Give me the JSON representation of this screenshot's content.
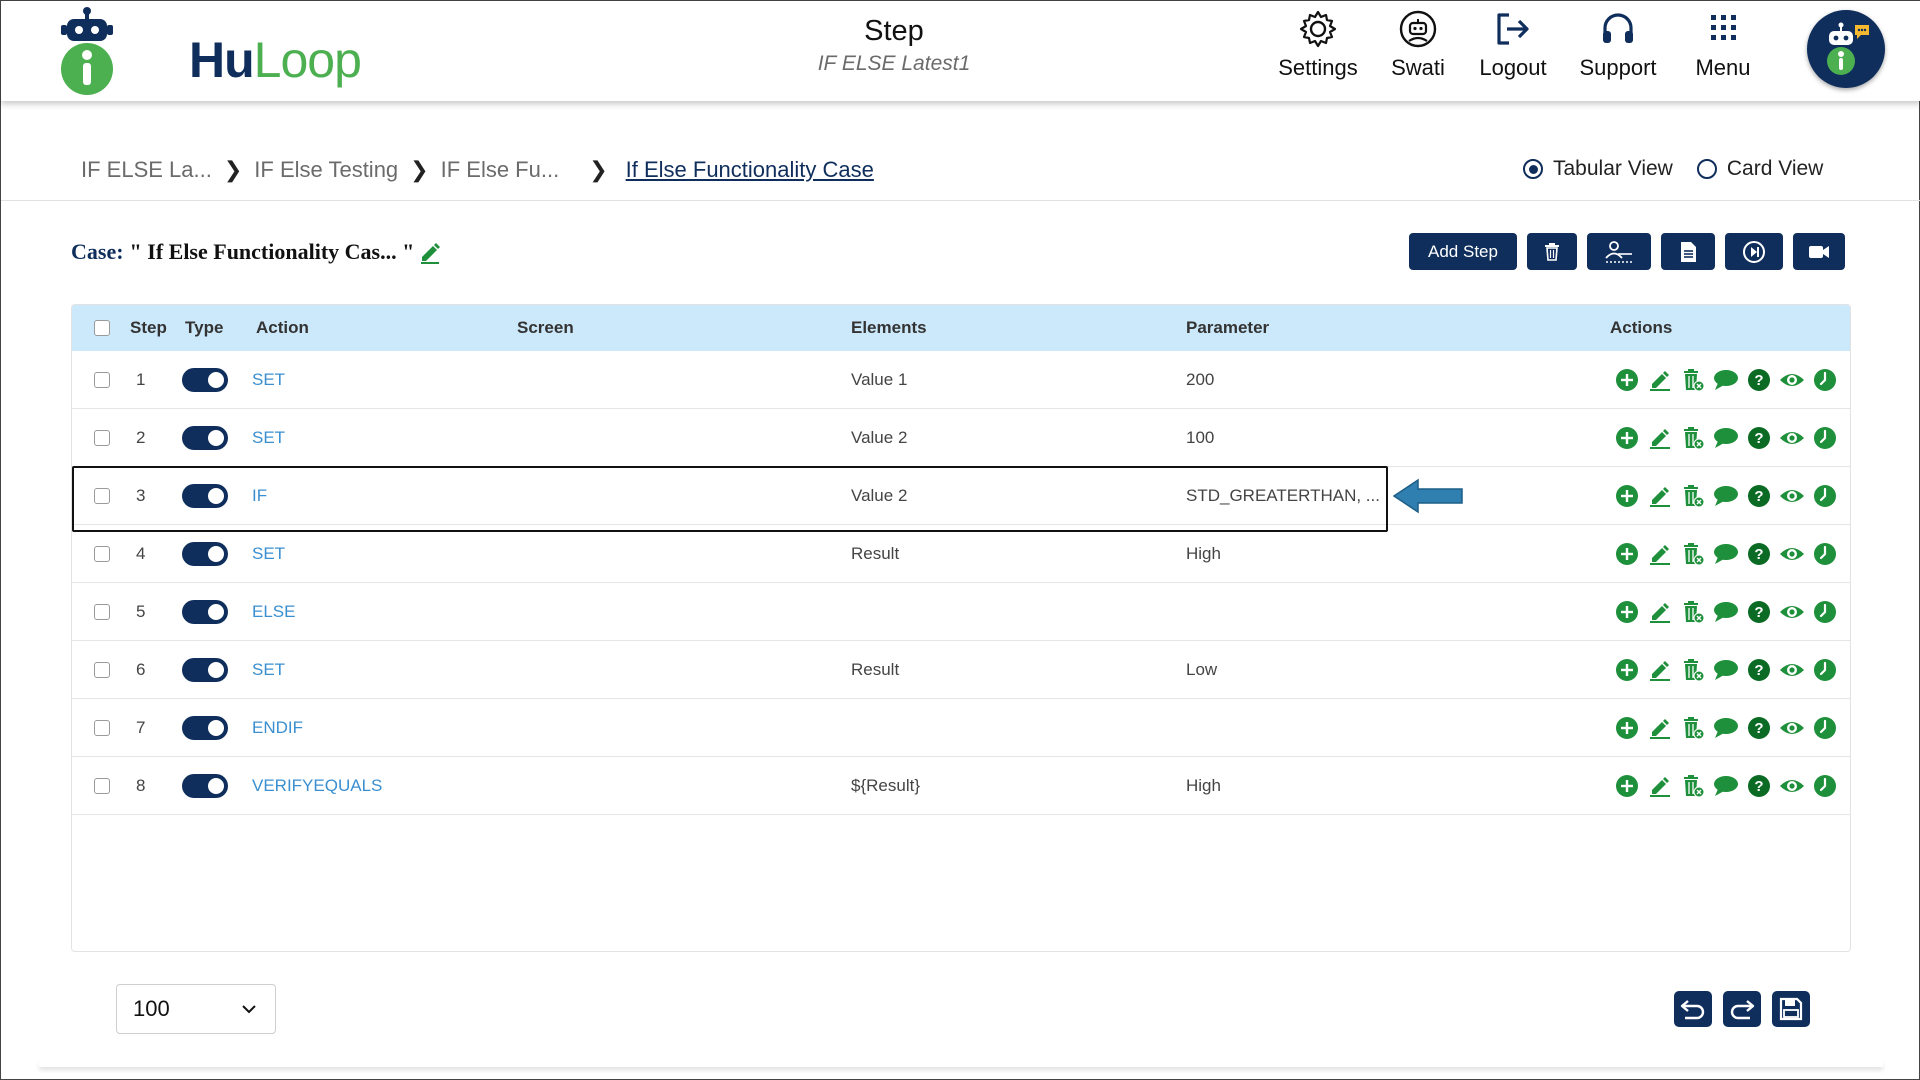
{
  "app": {
    "brand_hu": "Hu",
    "brand_loop": "Loop"
  },
  "heading": {
    "title": "Step",
    "subtitle": "IF ELSE Latest1"
  },
  "nav": {
    "settings": "Settings",
    "swati": "Swati",
    "logout": "Logout",
    "support": "Support",
    "menu": "Menu"
  },
  "breadcrumb": {
    "items": [
      "IF ELSE La...",
      "IF Else Testing",
      "IF Else Fu..."
    ],
    "current": "If Else Functionality Case"
  },
  "views": {
    "tabular": "Tabular View",
    "card": "Card View",
    "selected": "tabular"
  },
  "case": {
    "label": "Case:",
    "name": "\" If Else Functionality Cas... \""
  },
  "toolbar": {
    "add_step": "Add Step"
  },
  "table": {
    "headers": {
      "step": "Step",
      "type": "Type",
      "action": "Action",
      "screen": "Screen",
      "elements": "Elements",
      "parameter": "Parameter",
      "actions": "Actions"
    },
    "rows": [
      {
        "step": "1",
        "action": "SET",
        "screen": "",
        "elements": "Value 1",
        "parameter": "200"
      },
      {
        "step": "2",
        "action": "SET",
        "screen": "",
        "elements": "Value 2",
        "parameter": "100"
      },
      {
        "step": "3",
        "action": "IF",
        "screen": "",
        "elements": "Value 2",
        "parameter": "STD_GREATERTHAN, ..."
      },
      {
        "step": "4",
        "action": "SET",
        "screen": "",
        "elements": "Result",
        "parameter": "High"
      },
      {
        "step": "5",
        "action": "ELSE",
        "screen": "",
        "elements": "",
        "parameter": ""
      },
      {
        "step": "6",
        "action": "SET",
        "screen": "",
        "elements": "Result",
        "parameter": "Low"
      },
      {
        "step": "7",
        "action": "ENDIF",
        "screen": "",
        "elements": "",
        "parameter": ""
      },
      {
        "step": "8",
        "action": "VERIFYEQUALS",
        "screen": "",
        "elements": "${Result}",
        "parameter": "High"
      }
    ]
  },
  "pagination": {
    "page_size": "100"
  },
  "colors": {
    "navy": "#0f2e5c",
    "green": "#1e8f3a",
    "header_blue": "#cce9fb",
    "link": "#3a8fd0"
  }
}
